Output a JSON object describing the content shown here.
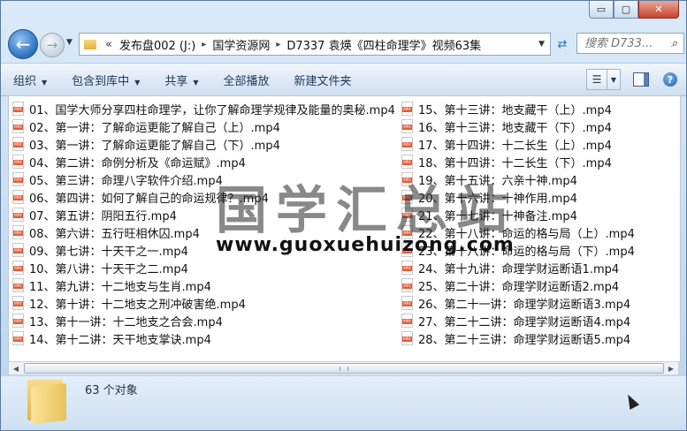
{
  "window": {
    "caption_buttons": {
      "minimize": "▭",
      "maximize": "▢",
      "close": "✕"
    }
  },
  "nav": {
    "back_icon": "arrow-left",
    "forward_icon": "arrow-right",
    "breadcrumb_overflow": "«",
    "breadcrumbs": [
      "发布盘002 (J:)",
      "国学资源网",
      "D7337 袁煐《四柱命理学》视频63集"
    ],
    "separator": "▸",
    "search_placeholder": "搜索 D733..."
  },
  "toolbar": {
    "organize": "组织",
    "include_in_library": "包含到库中",
    "share": "共享",
    "play_all": "全部播放",
    "new_folder": "新建文件夹"
  },
  "files": {
    "column1": [
      "01、国学大师分享四柱命理学，让你了解命理学规律及能量的奥秘.mp4",
      "02、第一讲：了解命运更能了解自己（上）.mp4",
      "03、第一讲：了解命运更能了解自己（下）.mp4",
      "04、第二讲：命例分析及《命运赋》.mp4",
      "05、第三讲：命理八字软件介绍.mp4",
      "06、第四讲：如何了解自己的命运规律？.mp4",
      "07、第五讲：阴阳五行.mp4",
      "08、第六讲：五行旺相休囚.mp4",
      "09、第七讲：十天干之一.mp4",
      "10、第八讲：十天干之二.mp4",
      "11、第九讲：十二地支与生肖.mp4",
      "12、第十讲：十二地支之刑冲破害绝.mp4",
      "13、第十一讲：十二地支之合会.mp4",
      "14、第十二讲：天干地支掌诀.mp4"
    ],
    "column2": [
      "15、第十三讲：地支藏干（上）.mp4",
      "16、第十三讲：地支藏干（下）.mp4",
      "17、第十四讲：十二长生（上）.mp4",
      "18、第十四讲：十二长生（下）.mp4",
      "19、第十五讲：六亲十神.mp4",
      "20、第十六讲：十神作用.mp4",
      "21、第十七讲：十神备注.mp4",
      "22、第十八讲：命运的格与局（上）.mp4",
      "23、第十八讲：命运的格与局（下）.mp4",
      "24、第十九讲：命理学财运断语1.mp4",
      "25、第二十讲：命理学财运断语2.mp4",
      "26、第二十一讲：命理学财运断语3.mp4",
      "27、第二十二讲：命理学财运断语4.mp4",
      "28、第二十三讲：命理学财运断语5.mp4"
    ]
  },
  "watermark": {
    "title": "国学汇总站",
    "url": "www.guoxuehuizong.com"
  },
  "status": {
    "count": "63 个对象"
  },
  "colors": {
    "accent": "#2b6fc0",
    "toolbar_text": "#1e395b",
    "mp4_badge": "#e35d3a"
  }
}
